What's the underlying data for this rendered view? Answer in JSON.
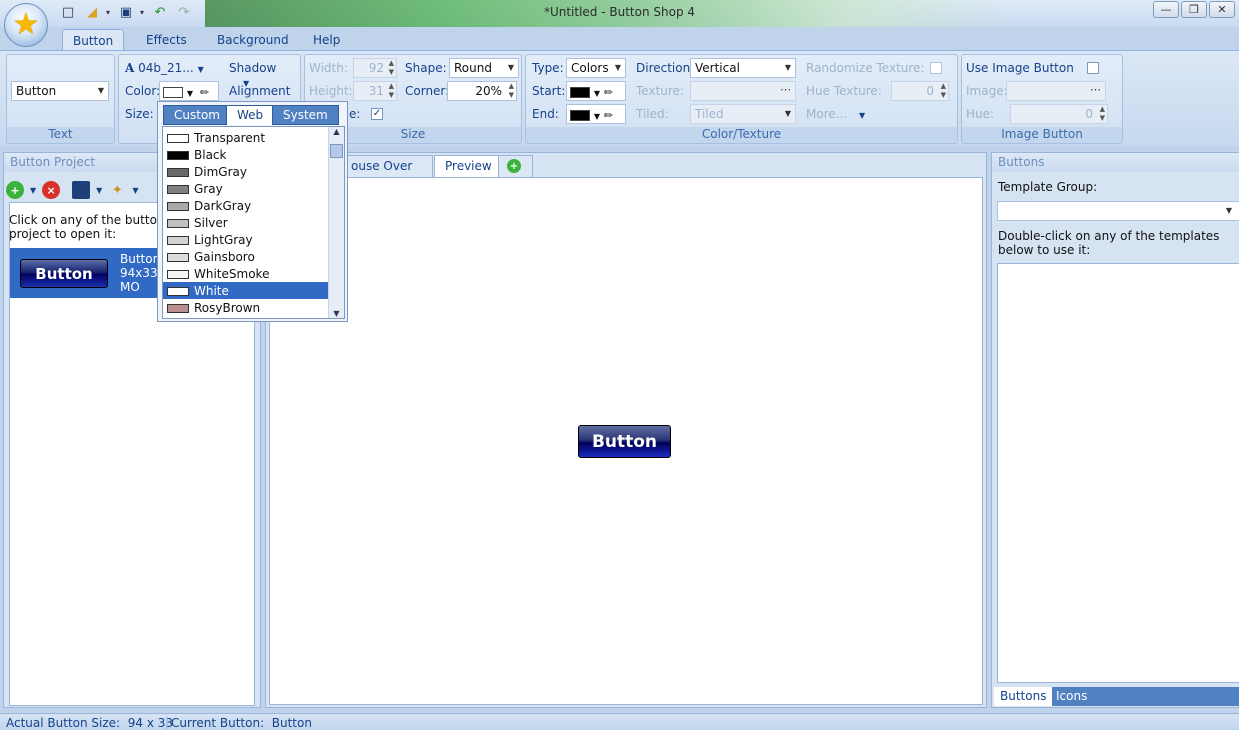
{
  "window": {
    "title": "*Untitled - Button Shop 4"
  },
  "ribbon_tabs": [
    "Button",
    "Effects",
    "Background",
    "Help"
  ],
  "text_group": {
    "label": "Text",
    "text_value": "Button"
  },
  "font_group": {
    "font_name": "04b_21...",
    "color_label": "Color:",
    "size_label": "Size:",
    "shadow_label": "Shadow",
    "alignment_label": "Alignment"
  },
  "size_group": {
    "label": "Size",
    "width_label": "Width:",
    "width_value": "92",
    "height_label": "Height:",
    "height_value": "31",
    "autosize_partial": "e:",
    "shape_label": "Shape:",
    "shape_value": "Round",
    "corner_label": "Corner:",
    "corner_value": "20%"
  },
  "color_group": {
    "label": "Color/Texture",
    "type_label": "Type:",
    "type_value": "Colors",
    "start_label": "Start:",
    "end_label": "End:",
    "direction_label": "Direction:",
    "direction_value": "Vertical",
    "texture_label": "Texture:",
    "tiled_label": "Tiled:",
    "tiled_value": "Tiled",
    "randomize_label": "Randomize Texture:",
    "hue_texture_label": "Hue Texture:",
    "hue_texture_value": "0",
    "more_label": "More...",
    "start_color": "#000000",
    "end_color": "#000000"
  },
  "image_group": {
    "label": "Image Button",
    "use_image_label": "Use Image Button",
    "image_label": "Image:",
    "hue_label": "Hue:",
    "hue_value": "0"
  },
  "project_panel": {
    "title": "Button Project",
    "hint": "Click on any of the buttons in the project to open it:",
    "hint_line1": "Click on any of the buttons",
    "hint_line2": "project to open it:",
    "item": {
      "thumb_text": "Button",
      "line1": "Button",
      "line2": "94x33",
      "line3": "MO"
    }
  },
  "doc_tabs": {
    "mouse_over": "ouse Over",
    "preview": "Preview"
  },
  "preview": {
    "button_text": "Button"
  },
  "buttons_panel": {
    "title": "Buttons",
    "template_group_label": "Template Group:",
    "hint_line1": "Double-click on any of the templates",
    "hint_line2": "below to use it:",
    "bottom_tabs": [
      "Buttons",
      "Icons"
    ]
  },
  "color_popup": {
    "tabs": [
      "Custom",
      "Web",
      "System"
    ],
    "active_tab": "Web",
    "items": [
      {
        "name": "Transparent",
        "color": "#ffffff"
      },
      {
        "name": "Black",
        "color": "#000000"
      },
      {
        "name": "DimGray",
        "color": "#696969"
      },
      {
        "name": "Gray",
        "color": "#808080"
      },
      {
        "name": "DarkGray",
        "color": "#a9a9a9"
      },
      {
        "name": "Silver",
        "color": "#c0c0c0"
      },
      {
        "name": "LightGray",
        "color": "#d3d3d3"
      },
      {
        "name": "Gainsboro",
        "color": "#dcdcdc"
      },
      {
        "name": "WhiteSmoke",
        "color": "#f5f5f5"
      },
      {
        "name": "White",
        "color": "#ffffff"
      },
      {
        "name": "RosyBrown",
        "color": "#bc8f8f"
      }
    ],
    "selected": "White"
  },
  "status": {
    "size_label": "Actual Button Size:",
    "size_value": "94 x 33",
    "current_label": "Current Button:",
    "current_value": "Button"
  }
}
